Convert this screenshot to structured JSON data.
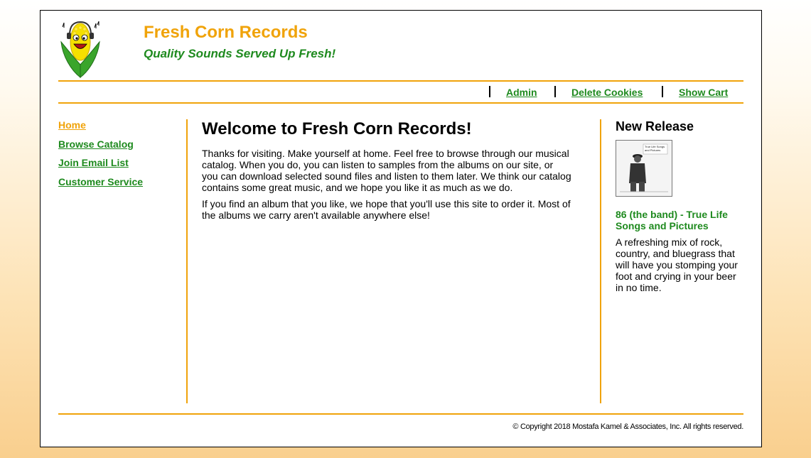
{
  "header": {
    "title": "Fresh Corn Records",
    "tagline": "Quality Sounds Served Up Fresh!",
    "logo_icon": "corn-mascot-icon"
  },
  "nav": {
    "admin": "Admin",
    "delete_cookies": "Delete Cookies",
    "show_cart": "Show Cart"
  },
  "sidebar": {
    "items": [
      {
        "label": "Home"
      },
      {
        "label": "Browse Catalog"
      },
      {
        "label": "Join Email List"
      },
      {
        "label": "Customer Service"
      }
    ]
  },
  "main": {
    "heading": "Welcome to Fresh Corn Records!",
    "paragraphs": [
      "Thanks for visiting. Make yourself at home. Feel free to browse through our musical catalog. When you do, you can listen to samples from the albums on our site, or you can download selected sound files and listen to them later. We think our catalog contains some great music, and we hope you like it as much as we do.",
      "If you find an album that you like, we hope that you'll use this site to order it. Most of the albums we carry aren't available anywhere else!"
    ]
  },
  "new_release": {
    "heading": "New Release",
    "cover_text": "True Life Songs and Pictures",
    "album_title": "86 (the band) - True Life Songs and Pictures",
    "description": "A refreshing mix of rock, country, and bluegrass that will have you stomping your foot and crying in your beer in no time."
  },
  "footer": {
    "copyright": "© Copyright 2018 Mostafa Kamel & Associates, Inc. All rights reserved."
  },
  "colors": {
    "accent_orange": "#f0a30a",
    "link_green": "#1e8a1e"
  }
}
